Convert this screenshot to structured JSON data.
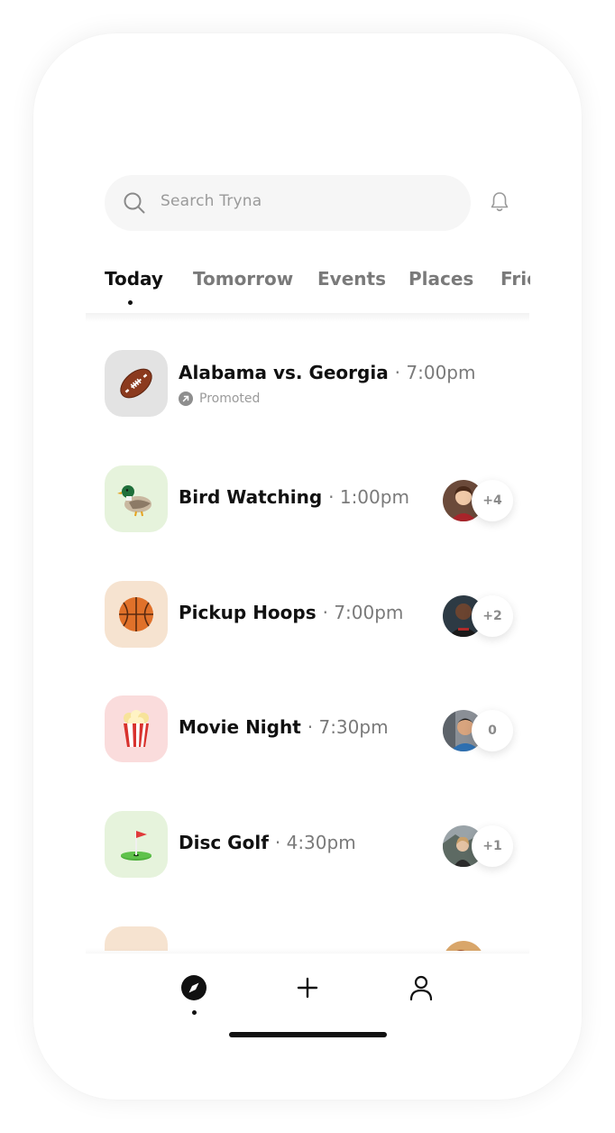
{
  "search": {
    "placeholder": "Search Tryna"
  },
  "tabs": [
    {
      "label": "Today",
      "active": true
    },
    {
      "label": "Tomorrow",
      "active": false
    },
    {
      "label": "Events",
      "active": false
    },
    {
      "label": "Places",
      "active": false
    },
    {
      "label": "Friends",
      "active": false
    }
  ],
  "rows": [
    {
      "title": "Alabama vs. Georgia",
      "time": "· 7:00pm",
      "promoted_label": "Promoted",
      "icon": "football-icon",
      "thumb_color": "#e3e3e3"
    },
    {
      "title": "Bird Watching",
      "time": "· 1:00pm",
      "count": "+4",
      "icon": "duck-icon",
      "thumb_color": "#e6f3dc"
    },
    {
      "title": "Pickup Hoops",
      "time": "· 7:00pm",
      "count": "+2",
      "icon": "basketball-icon",
      "thumb_color": "#f6e3d0"
    },
    {
      "title": "Movie Night",
      "time": "· 7:30pm",
      "count": "0",
      "icon": "popcorn-icon",
      "thumb_color": "#fadcdc"
    },
    {
      "title": "Disc Golf",
      "time": "· 4:30pm",
      "count": "+1",
      "icon": "golf-flag-icon",
      "thumb_color": "#e6f3dc"
    }
  ],
  "nav": [
    {
      "name": "explore-icon",
      "active": true
    },
    {
      "name": "add-icon",
      "active": false
    },
    {
      "name": "profile-icon",
      "active": false
    }
  ],
  "colors": {
    "active_text": "#111111",
    "inactive_text": "#7a7a7a",
    "search_bg": "#f6f6f6"
  }
}
